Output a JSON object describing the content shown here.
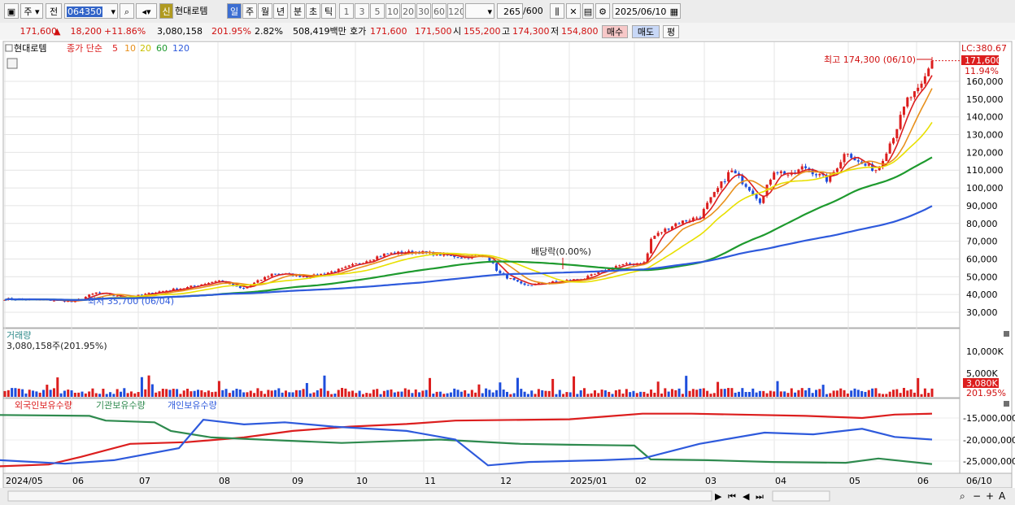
{
  "toolbar": {
    "market": "주",
    "prev_label": "전",
    "code": "064350",
    "badge": "신",
    "stock_name": "현대로템",
    "periods": [
      "일",
      "주",
      "월",
      "년",
      "분",
      "초",
      "틱"
    ],
    "minutes": [
      "1",
      "3",
      "5",
      "10",
      "20",
      "30",
      "60",
      "120"
    ],
    "count": "265",
    "count_total": "/600",
    "date": "2025/06/10"
  },
  "info": {
    "price": "171,600",
    "change": "18,200",
    "change_pct": "+11.86%",
    "volume": "3,080,158",
    "volume_ratio": "201.95%",
    "turnover": "2.82%",
    "amount": "508,419백만",
    "quote_label": "호가",
    "ask": "171,600",
    "bid": "171,500",
    "open_label": "시",
    "open": "155,200",
    "high_label": "고",
    "high": "174,300",
    "low_label": "저",
    "low": "154,800",
    "buy_button": "매수",
    "sell_button": "매도",
    "eval_button": "평"
  },
  "price_panel": {
    "name": "현대로템",
    "ma_label": "종가 단순",
    "ma_periods": [
      "5",
      "10",
      "20",
      "60",
      "120"
    ],
    "ma_colors": [
      "#dc1e1e",
      "#e8901c",
      "#e8e000",
      "#1e9a2e",
      "#2e5adc"
    ],
    "lc_label": "LC:380.67",
    "current_price": "171,600",
    "current_pct": "11.94%",
    "max_label": "최고 174,300 (06/10)",
    "min_label": "최저 35,700 (06/04)",
    "dividend_label": "배당락(0.00%)",
    "axis_labels": [
      "160,000",
      "150,000",
      "140,000",
      "130,000",
      "120,000",
      "110,000",
      "100,000",
      "90,000",
      "80,000",
      "70,000",
      "60,000",
      "50,000",
      "40,000",
      "30,000"
    ]
  },
  "volume_panel": {
    "title": "거래량",
    "value": "3,080,158주(201.95%)",
    "axis_labels": [
      "10,000K",
      "5,000K"
    ],
    "current": "3,080K",
    "current_pct": "201.95%"
  },
  "holdings_panel": {
    "series": [
      "외국인보유수량",
      "기관보유수량",
      "개인보유수량"
    ],
    "colors": [
      "#dc1e1e",
      "#2e8a4e",
      "#2e5adc"
    ],
    "axis_labels": [
      "-15,000,000",
      "-20,000,000",
      "-25,000,000"
    ]
  },
  "date_axis": {
    "labels": [
      "2024/05",
      "06",
      "07",
      "08",
      "09",
      "10",
      "11",
      "12",
      "2025/01",
      "02",
      "03",
      "04",
      "05",
      "06"
    ],
    "right_label": "06/10"
  }
}
